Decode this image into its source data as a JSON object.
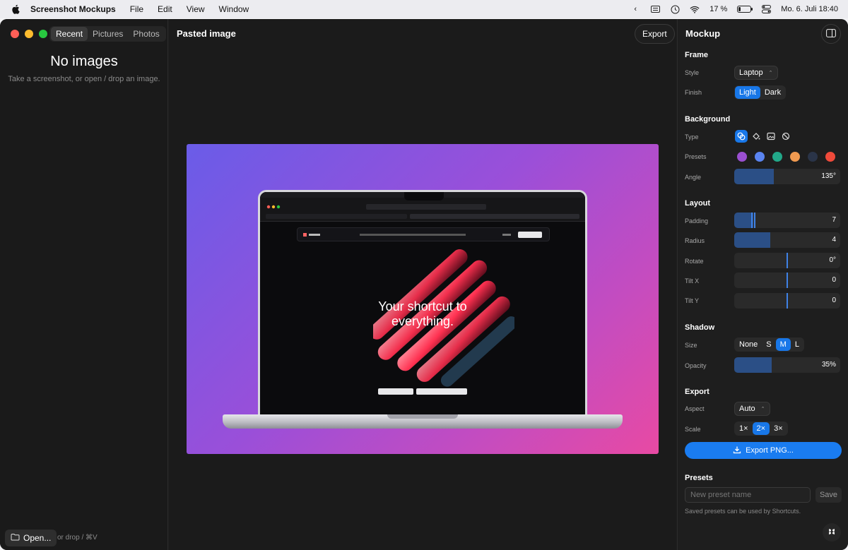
{
  "menubar": {
    "app_name": "Screenshot Mockups",
    "items": [
      "File",
      "Edit",
      "View",
      "Window"
    ],
    "battery": "17 %",
    "battery_level": 0.17,
    "datetime": "Mo. 6. Juli  18:40"
  },
  "sidebar": {
    "tabs": [
      "Recent",
      "Pictures",
      "Photos"
    ],
    "active_tab": "Recent",
    "empty_title": "No images",
    "empty_subtitle": "Take a screenshot, or open / drop an image.",
    "open_label": "Open...",
    "open_hint": "or drop / ⌘V"
  },
  "center": {
    "title": "Pasted image",
    "export_label": "Export",
    "preview": {
      "hero_title_line1": "Your shortcut to",
      "hero_title_line2": "everything."
    }
  },
  "panel": {
    "title": "Mockup",
    "frame": {
      "section": "Frame",
      "style_label": "Style",
      "style_value": "Laptop",
      "finish_label": "Finish",
      "finish_options": [
        "Light",
        "Dark"
      ],
      "finish_selected": "Light"
    },
    "background": {
      "section": "Background",
      "type_label": "Type",
      "presets_label": "Presets",
      "preset_colors": [
        "#9a4fd0",
        "#5a84f0",
        "#22a889",
        "#f09a50",
        "#2a3448",
        "#ef4a3a"
      ],
      "angle_label": "Angle",
      "angle_value": "135°",
      "angle_fraction": 0.375
    },
    "layout": {
      "section": "Layout",
      "padding_label": "Padding",
      "padding_value": "7",
      "radius_label": "Radius",
      "radius_value": "4",
      "rotate_label": "Rotate",
      "rotate_value": "0°",
      "tiltx_label": "Tilt X",
      "tiltx_value": "0",
      "tilty_label": "Tilt Y",
      "tilty_value": "0"
    },
    "shadow": {
      "section": "Shadow",
      "size_label": "Size",
      "size_options": [
        "None",
        "S",
        "M",
        "L"
      ],
      "size_selected": "M",
      "opacity_label": "Opacity",
      "opacity_value": "35%",
      "opacity_fraction": 0.35
    },
    "export": {
      "section": "Export",
      "aspect_label": "Aspect",
      "aspect_value": "Auto",
      "scale_label": "Scale",
      "scale_options": [
        "1×",
        "2×",
        "3×"
      ],
      "scale_selected": "2×",
      "export_png_label": "Export PNG..."
    },
    "presets": {
      "section": "Presets",
      "placeholder": "New preset name",
      "save_label": "Save",
      "hint": "Saved presets can be used by Shortcuts."
    }
  },
  "colors": {
    "accent": "#1877e8",
    "close": "#ff5f57",
    "minimize": "#febc2e",
    "zoom": "#28c840"
  }
}
